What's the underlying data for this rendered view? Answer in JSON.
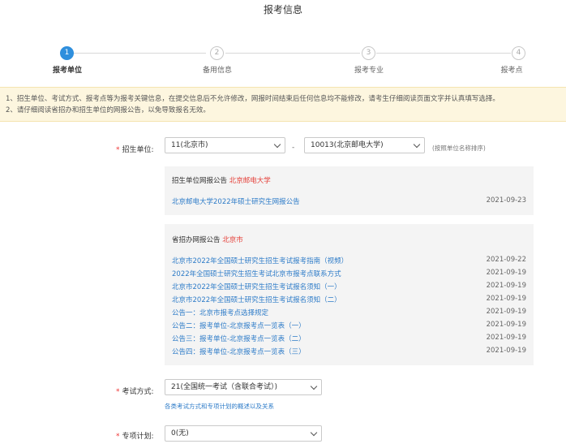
{
  "page": {
    "title": "报考信息"
  },
  "steps": [
    {
      "number": "1",
      "label": "报考单位"
    },
    {
      "number": "2",
      "label": "备用信息"
    },
    {
      "number": "3",
      "label": "报考专业"
    },
    {
      "number": "4",
      "label": "报考点"
    }
  ],
  "notice": {
    "line1": "1、招生单位、考试方式、报考点等为报考关键信息，在提交信息后不允许修改，网报时间结束后任何信息均不能修改，请考生仔细阅读页面文字并认真填写选择。",
    "line2": "2、请仔细阅读省招办和招生单位的网报公告，以免导致报名无效。"
  },
  "form": {
    "unit": {
      "required_mark": "*",
      "label": "招生单位:",
      "province_value": "11(北京市)",
      "separator": "-",
      "school_value": "10013(北京邮电大学)",
      "hint": "(按照单位名称排序)"
    },
    "exam_mode": {
      "required_mark": "*",
      "label": "考试方式:",
      "value": "21(全国统一考试（含联合考试）)",
      "link": "各类考试方式和专项计划的概述以及关系"
    },
    "special_plan": {
      "required_mark": "*",
      "label": "专项计划:",
      "value": "0(无)"
    }
  },
  "school_announcements": {
    "title_prefix": "招生单位网报公告",
    "title_name": "北京邮电大学",
    "items": [
      {
        "text": "北京邮电大学2022年硕士研究生网报公告",
        "date": "2021-09-23"
      }
    ]
  },
  "province_announcements": {
    "title_prefix": "省招办网报公告",
    "title_name": "北京市",
    "items": [
      {
        "text": "北京市2022年全国硕士研究生招生考试报考指南（视频）",
        "date": "2021-09-22"
      },
      {
        "text": "2022年全国硕士研究生招生考试北京市报考点联系方式",
        "date": "2021-09-19"
      },
      {
        "text": "北京市2022年全国硕士研究生招生考试报名须知（一）",
        "date": "2021-09-19"
      },
      {
        "text": "北京市2022年全国硕士研究生招生考试报名须知（二）",
        "date": "2021-09-19"
      },
      {
        "text": "公告一：北京市报考点选择规定",
        "date": "2021-09-19"
      },
      {
        "text": "公告二：报考单位-北京报考点一览表（一）",
        "date": "2021-09-19"
      },
      {
        "text": "公告三：报考单位-北京报考点一览表（二）",
        "date": "2021-09-19"
      },
      {
        "text": "公告四：报考单位-北京报考点一览表（三）",
        "date": "2021-09-19"
      }
    ]
  },
  "colors": {
    "accent": "#2f8fdd",
    "link": "#2d7bc8",
    "highlight_red": "#e5413a",
    "notice_bg": "#fdf6df"
  }
}
